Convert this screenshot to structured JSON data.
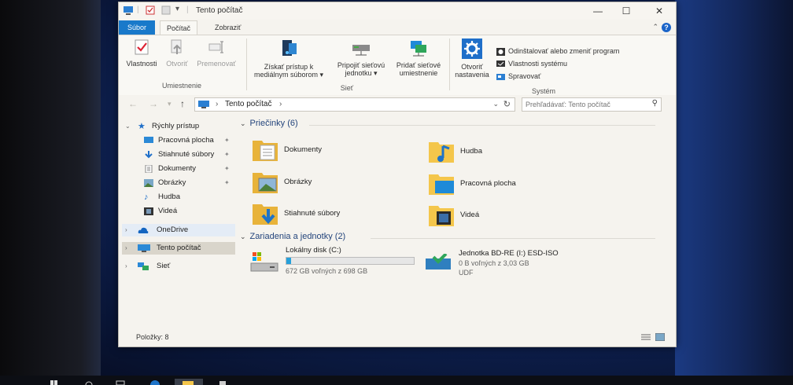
{
  "window": {
    "title": "Tento počítač"
  },
  "ribbon_tabs": [
    {
      "label": "Súbor"
    },
    {
      "label": "Počítač"
    },
    {
      "label": "Zobraziť"
    }
  ],
  "ribbon": {
    "location_group": {
      "label": "Umiestnenie",
      "properties": "Vlastnosti",
      "open": "Otvoriť",
      "rename": "Premenovať"
    },
    "network_group": {
      "label": "Sieť",
      "media_line1": "Získať prístup k",
      "media_line2": "mediálnym súborom ▾",
      "map_line1": "Pripojiť sieťovú",
      "map_line2": "jednotku ▾",
      "add_line1": "Pridať sieťové",
      "add_line2": "umiestnenie"
    },
    "system_group": {
      "label": "Systém",
      "settings_line1": "Otvoriť",
      "settings_line2": "nastavenia",
      "uninstall": "Odinštalovať alebo zmeniť program",
      "sysprops": "Vlastnosti systému",
      "manage": "Spravovať"
    }
  },
  "address": {
    "crumb": "Tento počítač",
    "search_placeholder": "Prehľadávať: Tento počítač"
  },
  "nav_pane": {
    "quick_access": "Rýchly prístup",
    "items": [
      {
        "label": "Pracovná plocha",
        "icon": "desktop-icon",
        "pinned": true
      },
      {
        "label": "Stiahnuté súbory",
        "icon": "download-icon",
        "pinned": true
      },
      {
        "label": "Dokumenty",
        "icon": "documents-icon",
        "pinned": true
      },
      {
        "label": "Obrázky",
        "icon": "pictures-icon",
        "pinned": true
      },
      {
        "label": "Hudba",
        "icon": "music-icon",
        "pinned": false
      },
      {
        "label": "Videá",
        "icon": "videos-icon",
        "pinned": false
      }
    ],
    "onedrive": "OneDrive",
    "this_pc": "Tento počítač",
    "network": "Sieť"
  },
  "content": {
    "folders_header": "Priečinky (6)",
    "folders": [
      {
        "label": "Dokumenty",
        "icon": "documents-folder-icon"
      },
      {
        "label": "Hudba",
        "icon": "music-folder-icon"
      },
      {
        "label": "Obrázky",
        "icon": "pictures-folder-icon"
      },
      {
        "label": "Pracovná plocha",
        "icon": "desktop-folder-icon"
      },
      {
        "label": "Stiahnuté súbory",
        "icon": "downloads-folder-icon"
      },
      {
        "label": "Videá",
        "icon": "videos-folder-icon"
      }
    ],
    "devices_header": "Zariadenia a jednotky (2)",
    "drives": [
      {
        "name": "Lokálny disk (C:)",
        "space": "672 GB voľných z 698 GB",
        "used_fraction": 0.04,
        "icon": "hard-drive-icon"
      },
      {
        "name": "Jednotka BD-RE (I:) ESD-ISO",
        "space": "0 B voľných z 3,03 GB",
        "fs": "UDF",
        "icon": "optical-drive-icon"
      }
    ]
  },
  "status": {
    "items": "Položky: 8"
  },
  "colors": {
    "file_tab": "#1979ca",
    "accent": "#26a0da",
    "folder": "#f4c64b"
  }
}
